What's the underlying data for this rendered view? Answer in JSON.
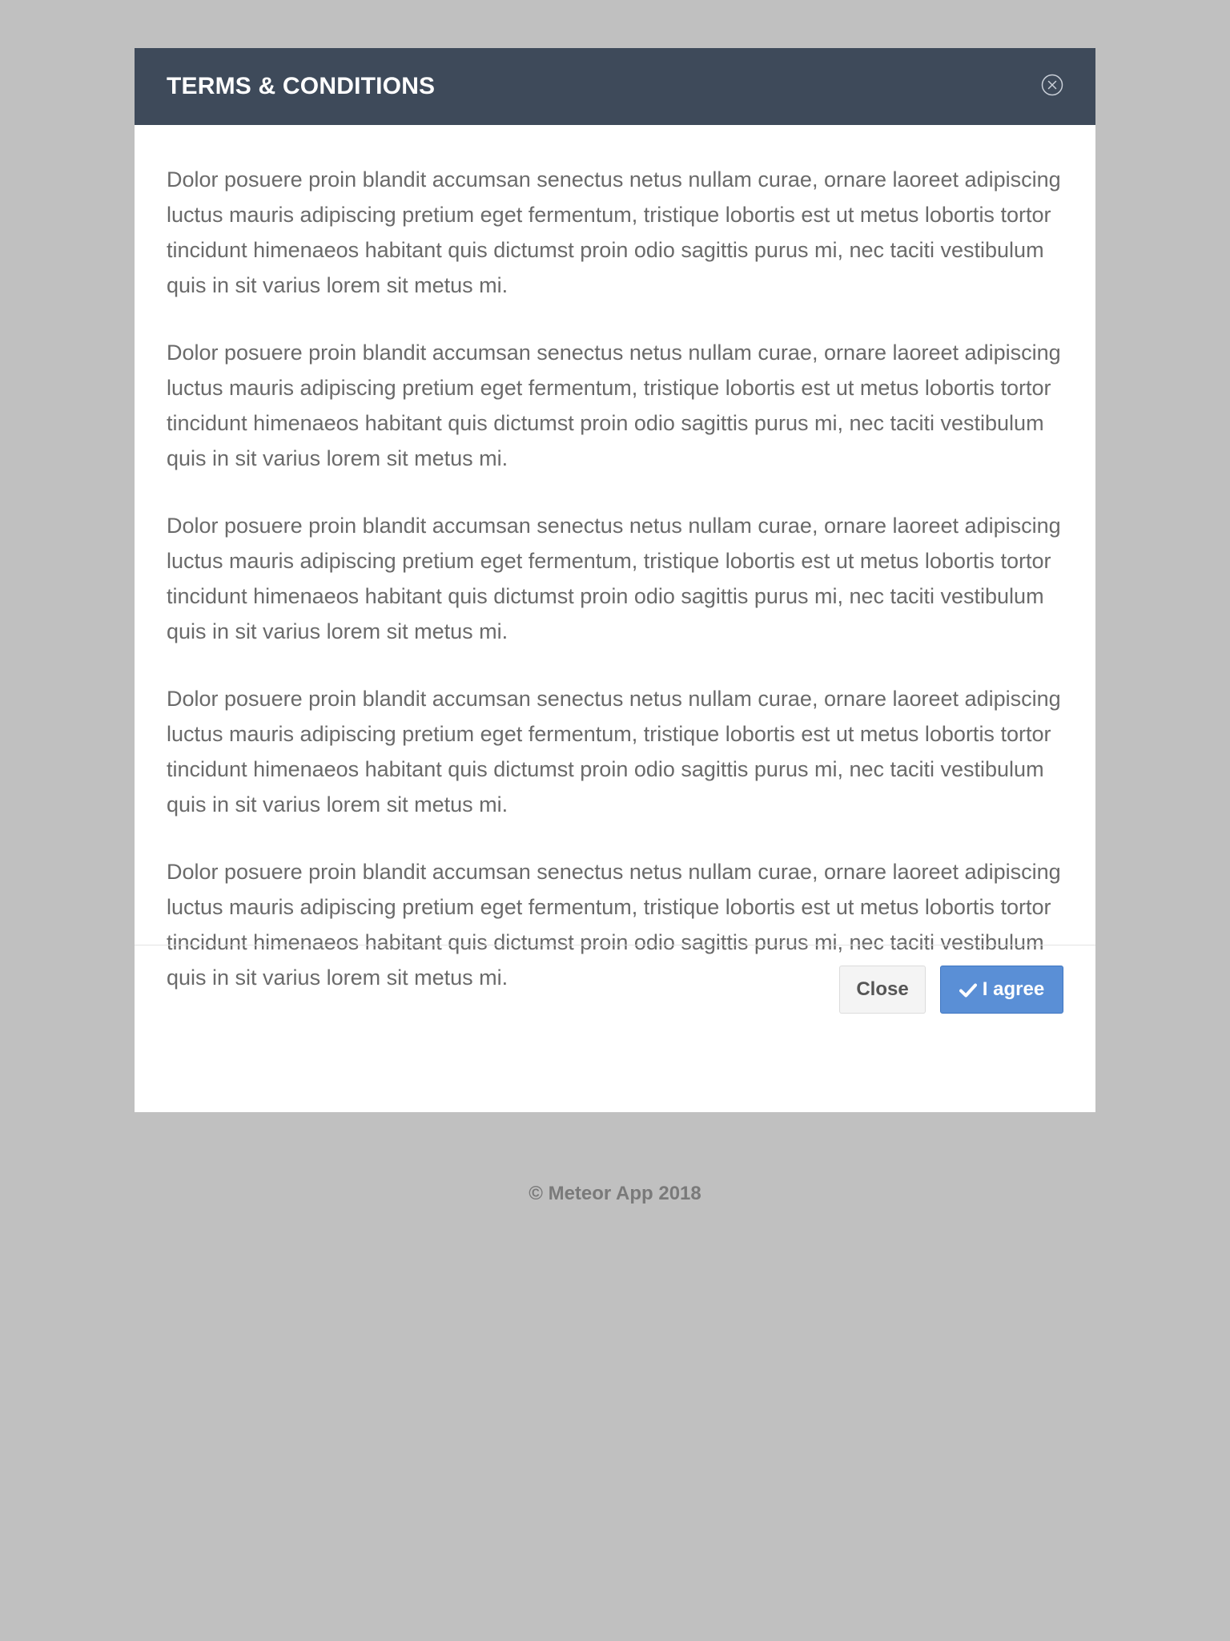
{
  "modal": {
    "title": "TERMS & CONDITIONS",
    "close_icon": "close-circle-icon",
    "paragraphs": [
      "Dolor posuere proin blandit accumsan senectus netus nullam curae, ornare laoreet adipiscing luctus mauris adipiscing pretium eget fermentum, tristique lobortis est ut metus lobortis tortor tincidunt himenaeos habitant quis dictumst proin odio sagittis purus mi, nec taciti vestibulum quis in sit varius lorem sit metus mi.",
      "Dolor posuere proin blandit accumsan senectus netus nullam curae, ornare laoreet adipiscing luctus mauris adipiscing pretium eget fermentum, tristique lobortis est ut metus lobortis tortor tincidunt himenaeos habitant quis dictumst proin odio sagittis purus mi, nec taciti vestibulum quis in sit varius lorem sit metus mi.",
      "Dolor posuere proin blandit accumsan senectus netus nullam curae, ornare laoreet adipiscing luctus mauris adipiscing pretium eget fermentum, tristique lobortis est ut metus lobortis tortor tincidunt himenaeos habitant quis dictumst proin odio sagittis purus mi, nec taciti vestibulum quis in sit varius lorem sit metus mi.",
      "Dolor posuere proin blandit accumsan senectus netus nullam curae, ornare laoreet adipiscing luctus mauris adipiscing pretium eget fermentum, tristique lobortis est ut metus lobortis tortor tincidunt himenaeos habitant quis dictumst proin odio sagittis purus mi, nec taciti vestibulum quis in sit varius lorem sit metus mi.",
      "Dolor posuere proin blandit accumsan senectus netus nullam curae, ornare laoreet adipiscing luctus mauris adipiscing pretium eget fermentum, tristique lobortis est ut metus lobortis tortor tincidunt himenaeos habitant quis dictumst proin odio sagittis purus mi, nec taciti vestibulum quis in sit varius lorem sit metus mi."
    ],
    "buttons": {
      "close_label": "Close",
      "agree_label": "I agree",
      "agree_icon": "check-icon"
    }
  },
  "footer": {
    "copyright": "© Meteor App 2018"
  },
  "colors": {
    "page_background": "#c0c0c0",
    "header_background": "#3e4a5a",
    "primary_button": "#5a8fd6",
    "body_text": "#6a6a6a"
  }
}
